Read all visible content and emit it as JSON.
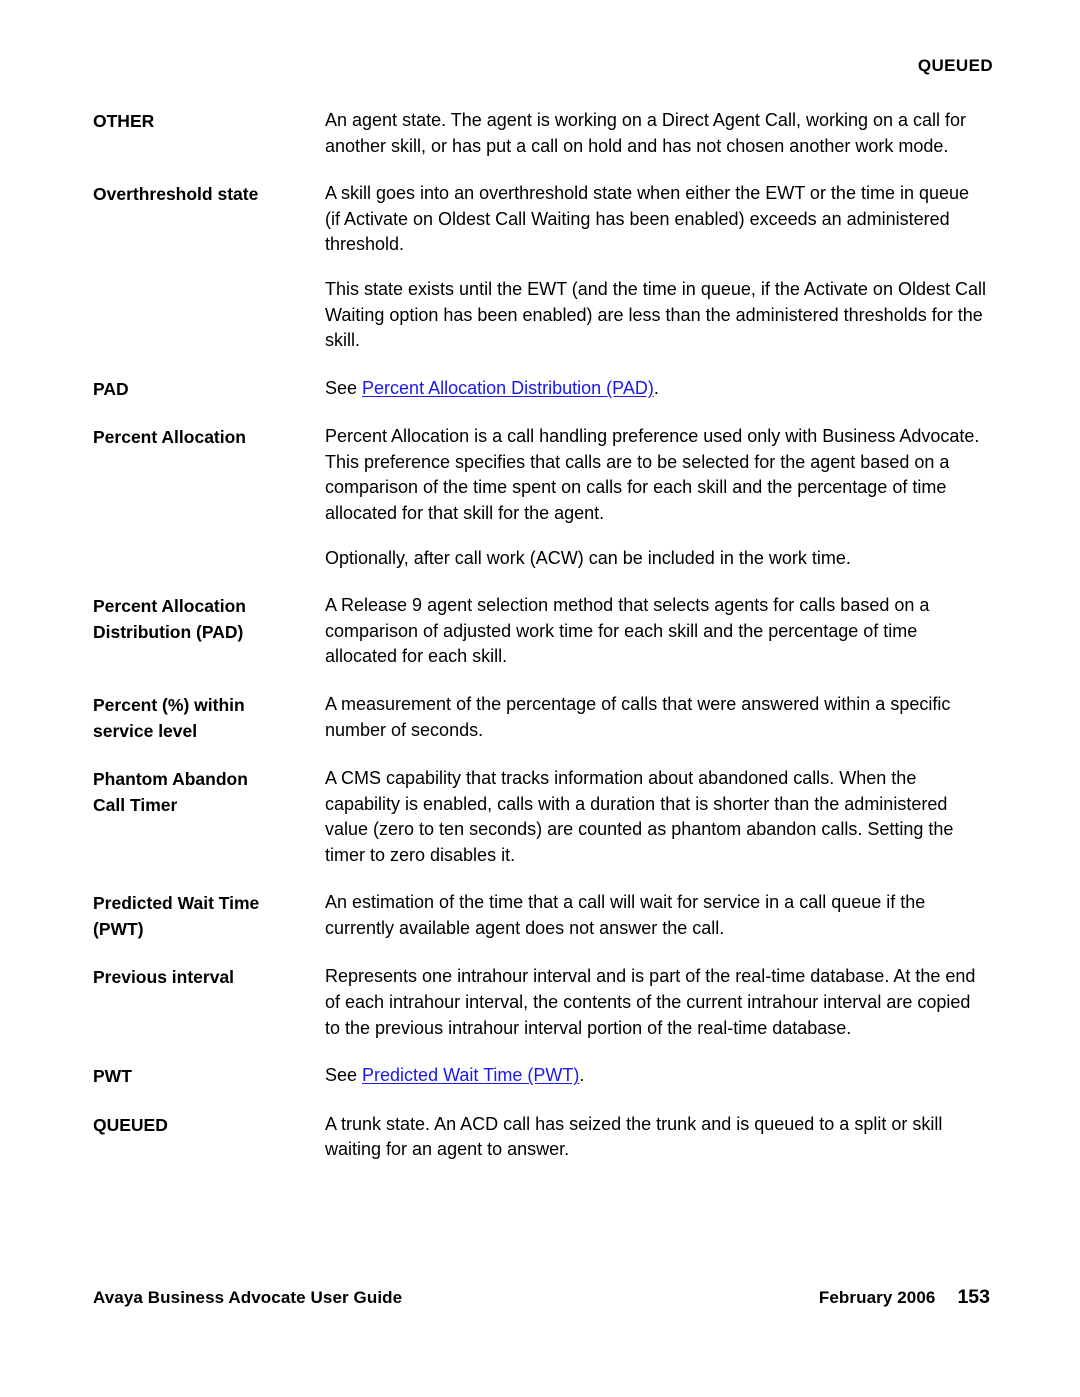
{
  "header": {
    "running_head": "QUEUED"
  },
  "glossary": {
    "entries": [
      {
        "term_lines": [
          "OTHER"
        ],
        "paragraphs": [
          {
            "parts": [
              {
                "type": "text",
                "text": "An agent state. The agent is working on a Direct Agent Call, working on a call for another skill, or has put a call on hold and has not chosen another work mode."
              }
            ]
          }
        ]
      },
      {
        "term_lines": [
          "Overthreshold state"
        ],
        "paragraphs": [
          {
            "parts": [
              {
                "type": "text",
                "text": "A skill goes into an overthreshold state when either the EWT or the time in queue (if Activate on Oldest Call Waiting has been enabled) exceeds an administered threshold."
              }
            ]
          },
          {
            "parts": [
              {
                "type": "text",
                "text": "This state exists until the EWT (and the time in queue, if the Activate on Oldest Call Waiting option has been enabled) are less than the administered thresholds for the skill."
              }
            ]
          }
        ]
      },
      {
        "term_lines": [
          "PAD"
        ],
        "paragraphs": [
          {
            "parts": [
              {
                "type": "text",
                "text": "See "
              },
              {
                "type": "link",
                "text": "Percent Allocation Distribution (PAD)"
              },
              {
                "type": "text",
                "text": "."
              }
            ]
          }
        ]
      },
      {
        "term_lines": [
          "Percent Allocation"
        ],
        "paragraphs": [
          {
            "parts": [
              {
                "type": "text",
                "text": "Percent Allocation is a call handling preference used only with Business Advocate. This preference specifies that calls are to be selected for the agent based on a comparison of the time spent on calls for each skill and the percentage of time allocated for that skill for the agent."
              }
            ]
          },
          {
            "parts": [
              {
                "type": "text",
                "text": "Optionally, after call work (ACW) can be included in the work time."
              }
            ]
          }
        ]
      },
      {
        "term_lines": [
          "Percent Allocation",
          "Distribution (PAD)"
        ],
        "paragraphs": [
          {
            "parts": [
              {
                "type": "text",
                "text": "A Release 9 agent selection method that selects agents for calls based on a comparison of adjusted work time for each skill and the percentage of time allocated for each skill."
              }
            ]
          }
        ]
      },
      {
        "term_lines": [
          "Percent (%) within",
          "service level"
        ],
        "paragraphs": [
          {
            "parts": [
              {
                "type": "text",
                "text": "A measurement of the percentage of calls that were answered within a specific number of seconds."
              }
            ]
          }
        ]
      },
      {
        "term_lines": [
          "Phantom Abandon",
          "Call Timer"
        ],
        "paragraphs": [
          {
            "parts": [
              {
                "type": "text",
                "text": "A CMS capability that tracks information about abandoned calls. When the capability is enabled, calls with a duration that is shorter than the administered value (zero to ten seconds) are counted as phantom abandon calls. Setting the timer to zero disables it."
              }
            ]
          }
        ]
      },
      {
        "term_lines": [
          "Predicted Wait Time",
          "(PWT)"
        ],
        "paragraphs": [
          {
            "parts": [
              {
                "type": "text",
                "text": "An estimation of the time that a call will wait for service in a call queue if the currently available agent does not answer the call."
              }
            ]
          }
        ]
      },
      {
        "term_lines": [
          "Previous interval"
        ],
        "paragraphs": [
          {
            "parts": [
              {
                "type": "text",
                "text": "Represents one intrahour interval and is part of the real-time database. At the end of each intrahour interval, the contents of the current intrahour interval are copied to the previous intrahour interval portion of the real-time database."
              }
            ]
          }
        ]
      },
      {
        "term_lines": [
          "PWT"
        ],
        "paragraphs": [
          {
            "parts": [
              {
                "type": "text",
                "text": "See "
              },
              {
                "type": "link",
                "text": "Predicted Wait Time (PWT)"
              },
              {
                "type": "text",
                "text": "."
              }
            ]
          }
        ]
      },
      {
        "term_lines": [
          "QUEUED"
        ],
        "paragraphs": [
          {
            "parts": [
              {
                "type": "text",
                "text": "A trunk state. An ACD call has seized the trunk and is queued to a split or skill waiting for an agent to answer."
              }
            ]
          }
        ]
      }
    ]
  },
  "footer": {
    "document_title": "Avaya Business Advocate User Guide",
    "date": "February 2006",
    "page_number": "153"
  },
  "colors": {
    "link": "#1a18ee",
    "text": "#000000",
    "background": "#ffffff"
  }
}
